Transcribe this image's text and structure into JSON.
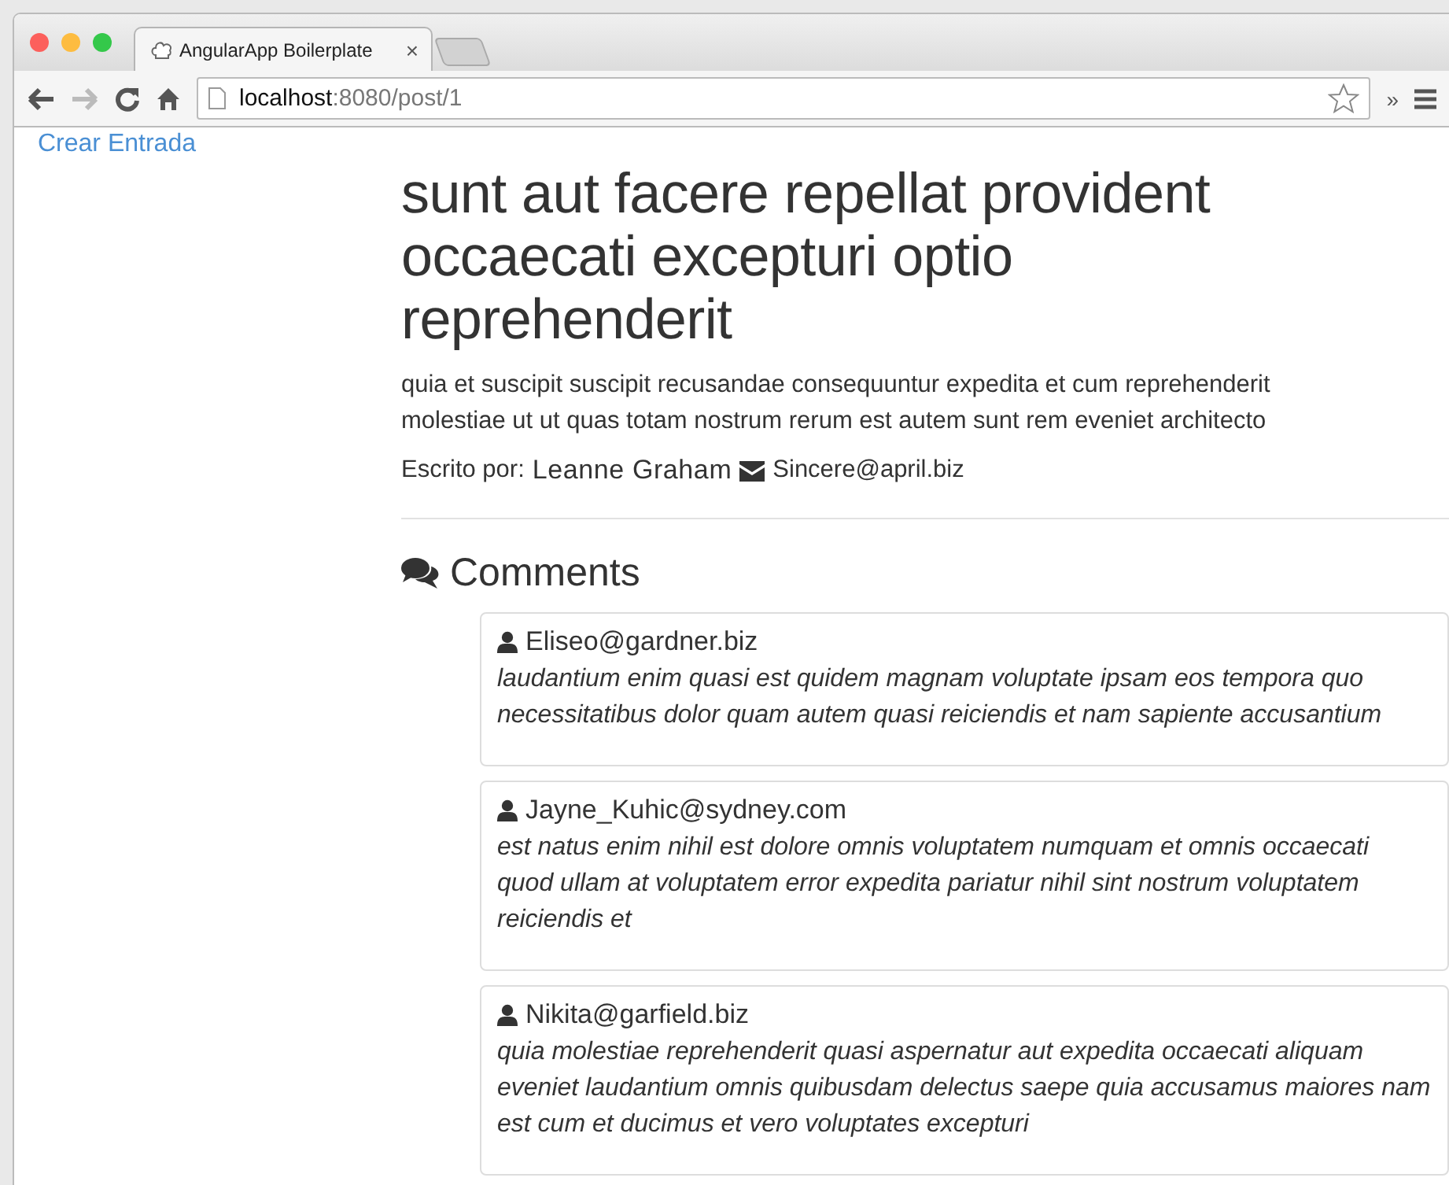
{
  "browser": {
    "tab": {
      "title": "AngularApp Boilerplate",
      "close": "×"
    },
    "url": {
      "host": "localhost",
      "path": ":8080/post/1"
    },
    "overflow": "»"
  },
  "sidebar": {
    "link": "Crear Entrada"
  },
  "post": {
    "title": "sunt aut facere repellat provident occaecati excepturi optio reprehenderit",
    "body": "quia et suscipit suscipit recusandae consequuntur expedita et cum reprehenderit molestiae ut ut quas totam nostrum rerum est autem sunt rem eveniet architecto",
    "byline_label": "Escrito por:",
    "author": "Leanne Graham",
    "email": "Sincere@april.biz"
  },
  "comments_heading": "Comments",
  "comments": [
    {
      "email": "Eliseo@gardner.biz",
      "body": "laudantium enim quasi est quidem magnam voluptate ipsam eos tempora quo necessitatibus dolor quam autem quasi reiciendis et nam sapiente accusantium"
    },
    {
      "email": "Jayne_Kuhic@sydney.com",
      "body": "est natus enim nihil est dolore omnis voluptatem numquam et omnis occaecati quod ullam at voluptatem error expedita pariatur nihil sint nostrum voluptatem reiciendis et"
    },
    {
      "email": "Nikita@garfield.biz",
      "body": "quia molestiae reprehenderit quasi aspernatur aut expedita occaecati aliquam eveniet laudantium omnis quibusdam delectus saepe quia accusamus maiores nam est cum et ducimus et vero voluptates excepturi"
    }
  ]
}
